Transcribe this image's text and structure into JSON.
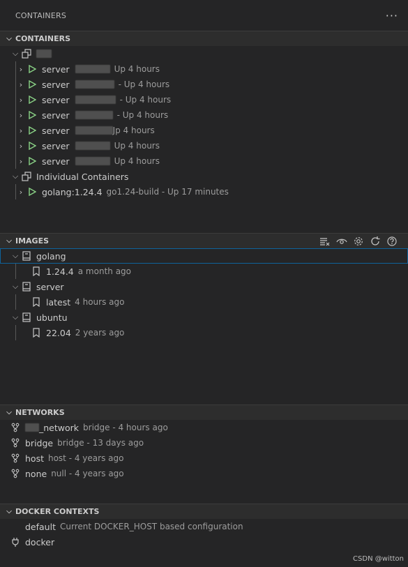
{
  "view": {
    "title": "CONTAINERS",
    "more_label": "···"
  },
  "containers": {
    "header": "CONTAINERS",
    "groups": [
      {
        "label": "",
        "items": [
          {
            "name": "server",
            "status": "Up 4 hours"
          },
          {
            "name": "server",
            "status": "- Up 4 hours"
          },
          {
            "name": "server",
            "status": "- Up 4 hours"
          },
          {
            "name": "server",
            "status": "- Up 4 hours"
          },
          {
            "name": "server",
            "status": "Jp 4 hours"
          },
          {
            "name": "server",
            "status": "Up 4 hours"
          },
          {
            "name": "server",
            "status": "Up 4 hours"
          }
        ]
      },
      {
        "label": "Individual Containers",
        "items": [
          {
            "name": "golang:1.24.4",
            "status": "go1.24-build - Up 17 minutes"
          }
        ]
      }
    ]
  },
  "images": {
    "header": "IMAGES",
    "repos": [
      {
        "name": "golang",
        "tag": "1.24.4",
        "age": "a month ago"
      },
      {
        "name": "server",
        "tag": "latest",
        "age": "4 hours ago"
      },
      {
        "name": "ubuntu",
        "tag": "22.04",
        "age": "2 years ago"
      }
    ]
  },
  "networks": {
    "header": "NETWORKS",
    "items": [
      {
        "name": "_network",
        "detail": "bridge - 4 hours ago"
      },
      {
        "name": "bridge",
        "detail": "bridge - 13 days ago"
      },
      {
        "name": "host",
        "detail": "host - 4 years ago"
      },
      {
        "name": "none",
        "detail": "null - 4 years ago"
      }
    ]
  },
  "contexts": {
    "header": "DOCKER CONTEXTS",
    "items": [
      {
        "name": "default",
        "detail": "Current DOCKER_HOST based configuration"
      },
      {
        "name": "docker",
        "detail": ""
      }
    ]
  },
  "watermark": "CSDN @witton",
  "colors": {
    "run_green": "#89d185",
    "selection_border": "#0e639c",
    "background": "#252526"
  }
}
